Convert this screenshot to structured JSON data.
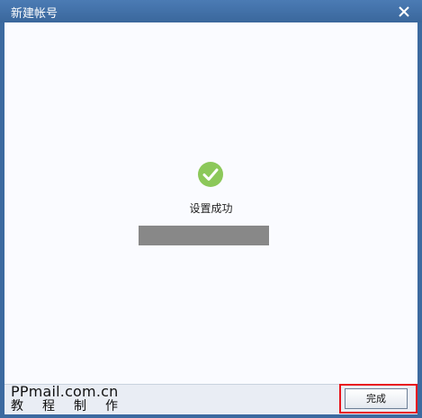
{
  "window": {
    "title": "新建帐号"
  },
  "content": {
    "status_text": "设置成功"
  },
  "footer": {
    "watermark_domain": "PPmail.com.cn",
    "watermark_caption": "教程制作",
    "finish_label": "完成"
  },
  "icons": {
    "close": "close-icon",
    "success": "checkmark-circle-icon"
  },
  "colors": {
    "titlebar": "#3c6aa0",
    "success_green": "#8cc85a",
    "highlight_red": "#e8141c",
    "progress_gray": "#888888"
  }
}
